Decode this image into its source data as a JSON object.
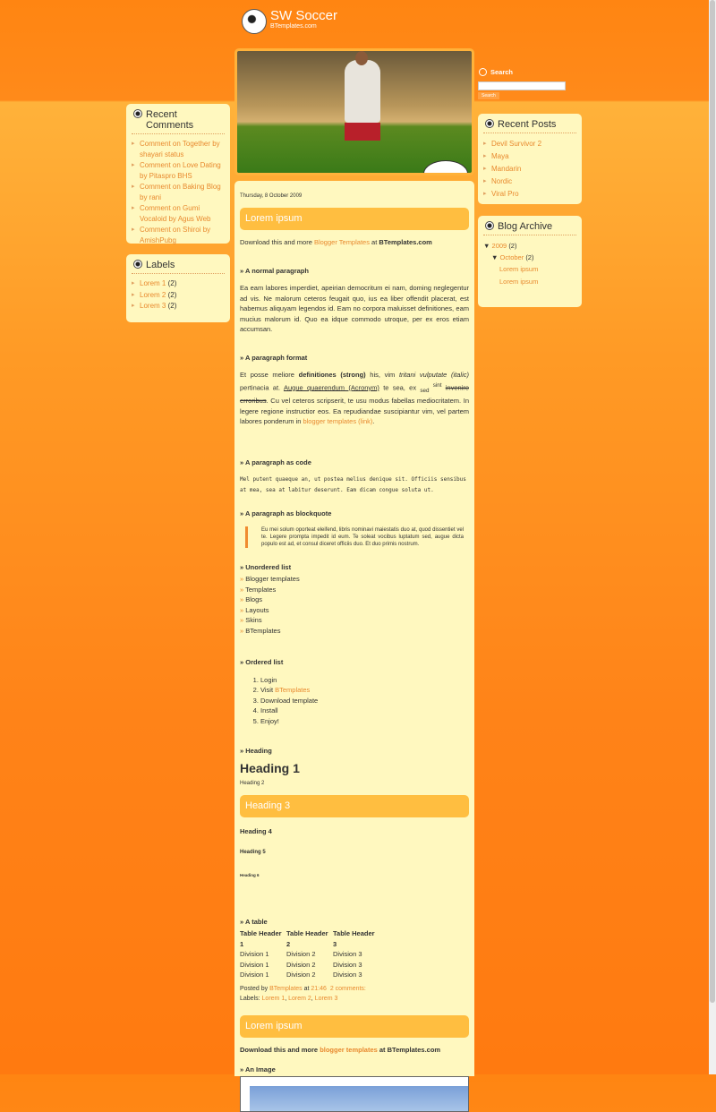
{
  "header": {
    "title": "SW Soccer",
    "subtitle": "BTemplates.com"
  },
  "search": {
    "label": "Search",
    "button": "Search",
    "value": ""
  },
  "recent_comments": {
    "title": "Recent Comments",
    "items": [
      "Comment on Together by shayari status",
      "Comment on Love Dating by Pitaspro BHS",
      "Comment on Baking Blog by rani",
      "Comment on Gumi Vocaloid by Agus Web",
      "Comment on Shiroi by AmishPubg"
    ]
  },
  "labels": {
    "title": "Labels",
    "items": [
      {
        "label": "Lorem 1",
        "count": "(2)"
      },
      {
        "label": "Lorem 2",
        "count": "(2)"
      },
      {
        "label": "Lorem 3",
        "count": "(2)"
      }
    ]
  },
  "recent_posts": {
    "title": "Recent Posts",
    "items": [
      "Devil Survivor 2",
      "Maya",
      "Mandarin",
      "Nordic",
      "Viral Pro"
    ]
  },
  "archive": {
    "title": "Blog Archive",
    "year": "2009",
    "year_count": "(2)",
    "month": "October",
    "month_count": "(2)",
    "posts": [
      "Lorem ipsum",
      "Lorem ipsum"
    ]
  },
  "post": {
    "date": "Thursday, 8 October 2009",
    "title": "Lorem ipsum",
    "intro": {
      "pre": "Download this and more ",
      "link": "Blogger Templates",
      "mid": " at ",
      "bold": "BTemplates.com"
    },
    "h_normal": "» A normal paragraph",
    "normal": "Ea eam labores imperdiet, apeirian democritum ei nam, doming neglegentur ad vis. Ne malorum ceteros feugait quo, ius ea liber offendit placerat, est habemus aliquyam legendos id. Eam no corpora maluisset definitiones, eam mucius malorum id. Quo ea idque commodo utroque, per ex eros etiam accumsan.",
    "h_format": "» A paragraph format",
    "fmt": {
      "t1": "Et posse meliore ",
      "strong": "definitiones (strong)",
      "t2": " his, vim ",
      "em1": "tritani vulputate (italic)",
      "t3": " pertinacia at. ",
      "acr": "Augue quaerendum (Acronym)",
      "t4": " te sea, ex ",
      "sub": "sed",
      "sup": "sint",
      "del": "invenire erroribus",
      "t5": ". Cu vel ceteros scripserit, te usu modus fabellas mediocritatem. In legere regione instructior eos. Ea repudiandae suscipiantur vim, vel partem labores ponderum in ",
      "link": "blogger templates (link)",
      "t6": "."
    },
    "h_code": "» A paragraph as code",
    "code": "Mel putent quaeque an, ut postea melius denique sit. Officiis sensibus at mea, sea at labitur deserunt. Eam dicam congue soluta ut.",
    "h_quote": "» A paragraph as blockquote",
    "quote": "Eu mei solum oporteat eleifend, libris nominavi maiestatis duo at, quod dissentiet vel te. Legere prompta impedit id eum. Te soleat vocibus luptatum sed, augue dicta populo est ad, et consul diceret officiis duo. Et duo primis nostrum.",
    "h_ul": "» Unordered list",
    "ul": [
      "Blogger templates",
      "Templates",
      "Blogs",
      "Layouts",
      "Skins",
      "BTemplates"
    ],
    "h_ol": "» Ordered list",
    "ol": {
      "i1": "Login",
      "i2_pre": "Visit ",
      "i2_link": "BTemplates",
      "i3": "Download template",
      "i4": "Install",
      "i5": "Enjoy!"
    },
    "h_heading": "» Heading",
    "headings": [
      "Heading 1",
      "Heading 2",
      "Heading 3",
      "Heading 4",
      "Heading 5",
      "Heading 6"
    ],
    "h_table": "» A table",
    "table": {
      "headers": [
        "Table Header 1",
        "Table Header 2",
        "Table Header 3"
      ],
      "rows": [
        [
          "Division 1",
          "Division 2",
          "Division 3"
        ],
        [
          "Division 1",
          "Division 2",
          "Division 3"
        ],
        [
          "Division 1",
          "Division 2",
          "Division 3"
        ]
      ]
    },
    "footer": {
      "posted_by": "Posted by ",
      "author": "BTemplates",
      "at": " at ",
      "time": "21:46",
      "comments": "2 comments:",
      "labels_label": "Labels: ",
      "labels": [
        "Lorem 1",
        "Lorem 2",
        "Lorem 3"
      ]
    }
  },
  "post2": {
    "title": "Lorem ipsum",
    "pre": "Download this and more ",
    "link": "blogger templates",
    "post": " at BTemplates.com",
    "h_image": "» An Image"
  }
}
